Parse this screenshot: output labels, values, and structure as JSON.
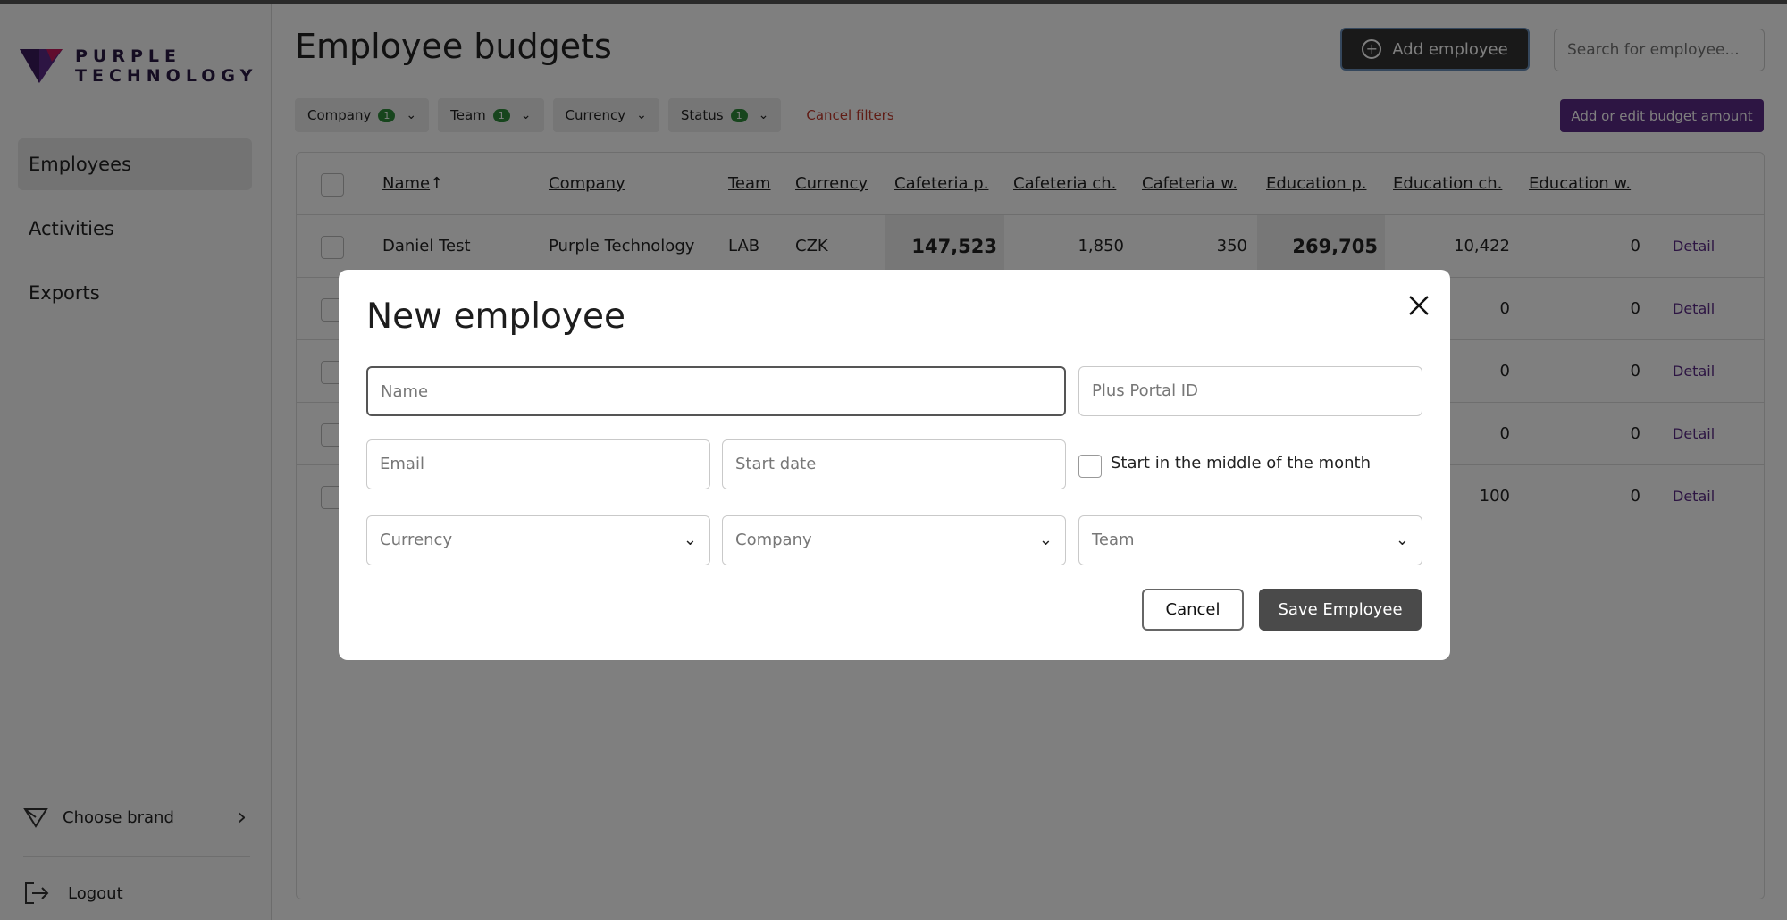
{
  "sidebar": {
    "logo_line1": "PURPLE",
    "logo_line2": "TECHNOLOGY",
    "nav": [
      "Employees",
      "Activities",
      "Exports"
    ],
    "choose_brand": "Choose brand",
    "logout": "Logout"
  },
  "header": {
    "title": "Employee budgets",
    "add_employee": "Add employee",
    "search_placeholder": "Search for employee..."
  },
  "filters": {
    "company": "Company",
    "company_count": "1",
    "team": "Team",
    "team_count": "1",
    "currency": "Currency",
    "status": "Status",
    "status_count": "1",
    "cancel": "Cancel filters",
    "budget_button": "Add or edit budget amount"
  },
  "table": {
    "headers": [
      "Name",
      "Company",
      "Team",
      "Currency",
      "Cafeteria p.",
      "Cafeteria ch.",
      "Cafeteria w.",
      "Education p.",
      "Education ch.",
      "Education w."
    ],
    "sort_indicator": "↑",
    "detail_label": "Detail",
    "rows": [
      {
        "name": "Daniel Test",
        "company": "Purple Technology",
        "team": "LAB",
        "currency": "CZK",
        "cafe_p": "147,523",
        "cafe_ch": "1,850",
        "cafe_w": "350",
        "edu_p": "269,705",
        "edu_ch": "10,422",
        "edu_w": "0"
      },
      {
        "edu_ch": "0",
        "edu_w": "0"
      },
      {
        "edu_ch": "0",
        "edu_w": "0"
      },
      {
        "edu_ch": "0",
        "edu_w": "0"
      },
      {
        "edu_ch": "100",
        "edu_w": "0"
      }
    ]
  },
  "modal": {
    "title": "New employee",
    "name_placeholder": "Name",
    "portal_placeholder": "Plus Portal ID",
    "email_placeholder": "Email",
    "start_placeholder": "Start date",
    "mid_month_label": "Start in the middle of the month",
    "currency_placeholder": "Currency",
    "company_placeholder": "Company",
    "team_placeholder": "Team",
    "cancel": "Cancel",
    "save": "Save Employee"
  },
  "colors": {
    "brand_purple": "#5b2a86",
    "badge_green": "#2e8b3a",
    "cancel_red": "#c0392b"
  }
}
